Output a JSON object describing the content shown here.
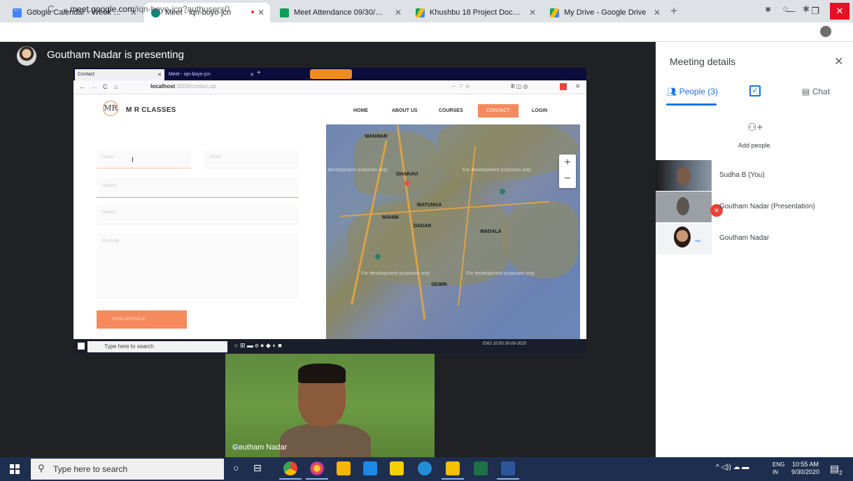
{
  "tabs": [
    {
      "label": "Google Calendar - Week of Sept",
      "icon": "calendar-icon",
      "color": "#4285f4"
    },
    {
      "label": "Meet - iqn-boyo-jcn",
      "icon": "meet-icon",
      "color": "#00897b",
      "active": true
    },
    {
      "label": "Meet Attendance 09/30/2020 -",
      "icon": "sheets-icon",
      "color": "#0f9d58"
    },
    {
      "label": "Khushbu 18 Project Document",
      "icon": "drive-icon",
      "color": "#fbbc04"
    },
    {
      "label": "My Drive - Google Drive",
      "icon": "drive-icon",
      "color": "#fbbc04"
    }
  ],
  "addressbar": {
    "host": "meet.google.com",
    "path": "/iqn-boyo-jcn?authuser=0"
  },
  "presenter": {
    "text": "Goutham Nadar is presenting"
  },
  "shared_screen": {
    "firefox_tabs": [
      "Contact",
      "Meet - iqn-boyo-jcn"
    ],
    "url_host": "localhost",
    "url_rest": ":3000/contact.sp",
    "site": {
      "logo_mark": "MR",
      "logo_text": "M R CLASSES",
      "nav": [
        "HOME",
        "ABOUT US",
        "COURSES",
        "CONTACT",
        "LOGIN"
      ],
      "fields": [
        "Name",
        "Email",
        "Subject",
        "Subject",
        "Message"
      ],
      "send_label": "SEND MESSAGE"
    },
    "map": {
      "watermark": "For development purposes only",
      "places": [
        "WANWAR",
        "DHARAVI",
        "MATUNGA",
        "DADAR",
        "SEWRI",
        "MAHIM",
        "WADALA"
      ],
      "zoom_in": "+",
      "zoom_out": "−"
    },
    "taskbar": {
      "search": "Type here to search",
      "tray_lang": "ENG",
      "time": "10:50",
      "date": "30-09-2020"
    }
  },
  "self_tile": {
    "name": "Goutham Nadar"
  },
  "panel": {
    "title": "Meeting details",
    "tab_people": "People (3)",
    "tab_chat": "Chat",
    "add_people": "Add people",
    "people": [
      {
        "name": "Sudha B (You)"
      },
      {
        "name": "Goutham Nadar (Presentation)"
      },
      {
        "name": "Goutham Nadar"
      }
    ]
  },
  "taskbar": {
    "search_placeholder": "Type here to search",
    "lang_top": "ENG",
    "lang_bottom": "IN",
    "time": "10:55 AM",
    "date": "9/30/2020",
    "notif_count": "2"
  }
}
